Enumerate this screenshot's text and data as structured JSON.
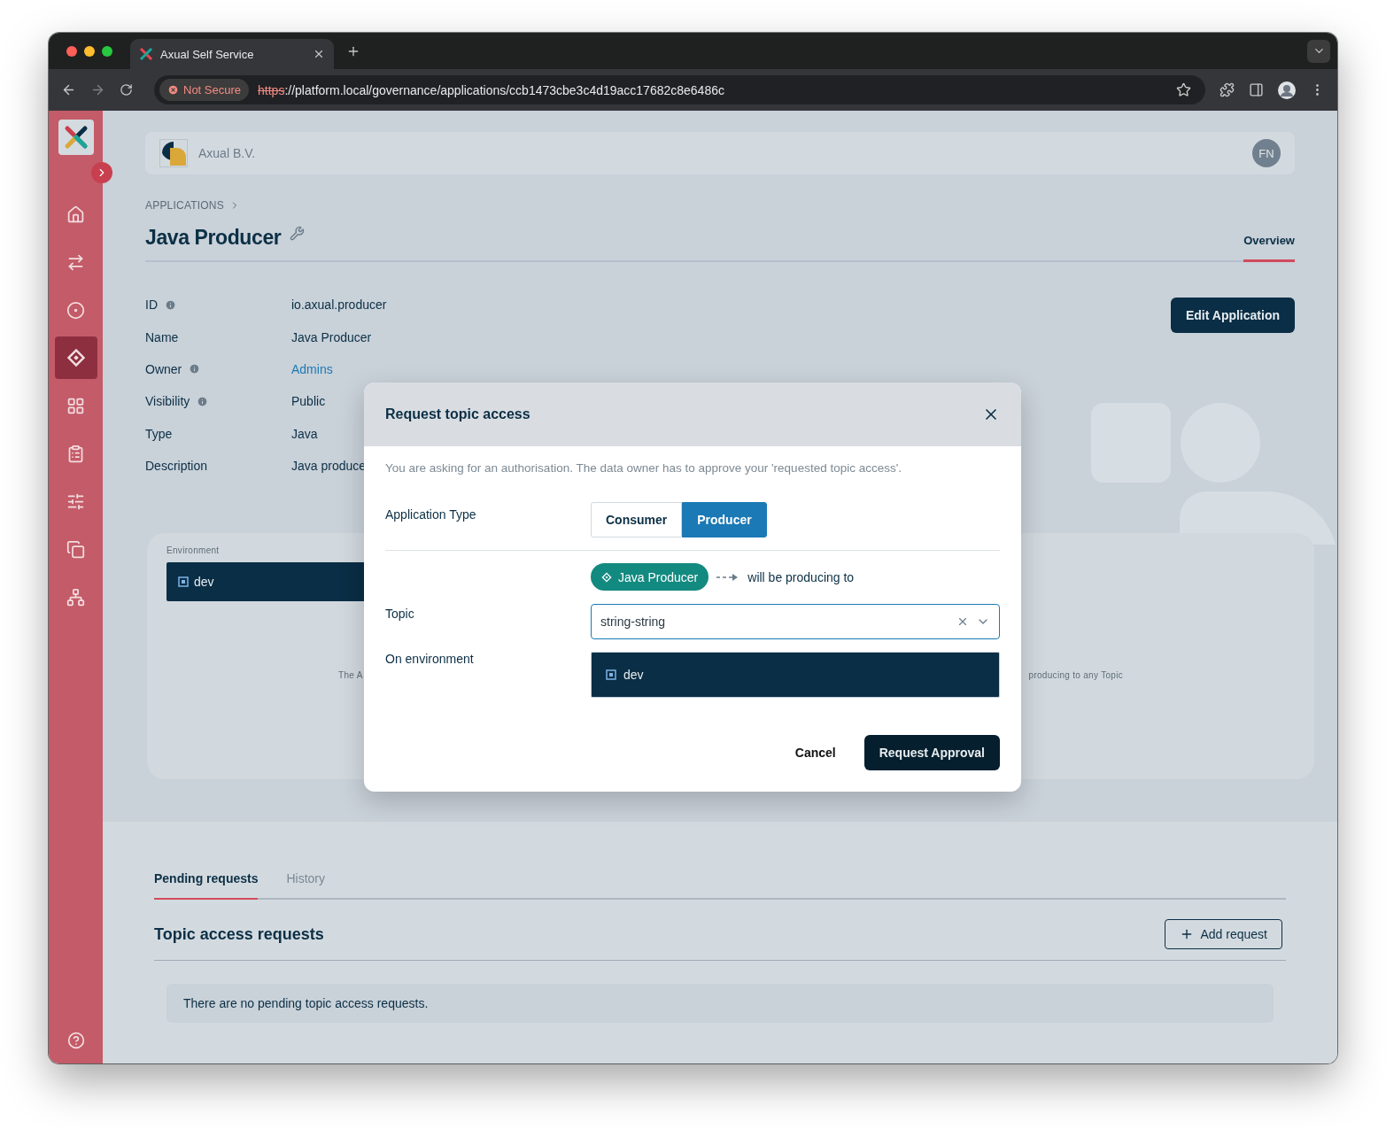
{
  "browser": {
    "tab_title": "Axual Self Service",
    "security": "Not Secure",
    "url": {
      "scheme": "https",
      "rest": "://platform.local/governance/applications/ccb1473cbe3c4d19acc17682c8e6486c"
    }
  },
  "sidebar": {
    "items": [
      {
        "selected": false
      },
      {
        "selected": false
      },
      {
        "selected": false
      },
      {
        "selected": true
      },
      {
        "selected": false
      },
      {
        "selected": false
      },
      {
        "selected": false
      },
      {
        "selected": false
      },
      {
        "selected": false
      }
    ]
  },
  "header": {
    "organization": "Axual B.V.",
    "user_initials": "FN"
  },
  "breadcrumb": [
    "APPLICATIONS"
  ],
  "title": "Java Producer",
  "tabs": [
    {
      "label": "Overview",
      "selected": true
    }
  ],
  "details": [
    {
      "label": "ID",
      "info": true,
      "value": "io.axual.producer",
      "kind": "text"
    },
    {
      "label": "Name",
      "info": false,
      "value": "Java Producer",
      "kind": "text"
    },
    {
      "label": "Owner",
      "info": true,
      "value": "Admins",
      "kind": "link"
    },
    {
      "label": "Visibility",
      "info": true,
      "value": "Public",
      "kind": "text"
    },
    {
      "label": "Type",
      "info": false,
      "value": "Java",
      "kind": "text"
    },
    {
      "label": "Description",
      "info": false,
      "value": "Java produce",
      "kind": "text"
    }
  ],
  "edit_button": "Edit Application",
  "environment_panel": {
    "label": "Environment",
    "environments": [
      {
        "name": "dev",
        "selected": true
      }
    ],
    "message_start": "The A",
    "message_end": "producing to any Topic"
  },
  "modal": {
    "title": "Request topic access",
    "description": "You are asking for an authorisation. The data owner has to approve your 'requested topic access'.",
    "application_type": {
      "label": "Application Type",
      "options": [
        {
          "label": "Consumer",
          "selected": false
        },
        {
          "label": "Producer",
          "selected": true
        }
      ]
    },
    "application_chip": "Java Producer",
    "relation": "will be producing to",
    "topic": {
      "label": "Topic",
      "value": "string-string"
    },
    "environment": {
      "label": "On environment",
      "options": [
        {
          "name": "dev",
          "selected": true
        }
      ]
    },
    "cancel": "Cancel",
    "submit": "Request Approval"
  },
  "requests": {
    "tabs": [
      {
        "label": "Pending requests",
        "selected": true
      },
      {
        "label": "History",
        "selected": false
      }
    ],
    "heading": "Topic access requests",
    "add_button": "Add request",
    "empty_message": "There are no pending topic access requests."
  }
}
